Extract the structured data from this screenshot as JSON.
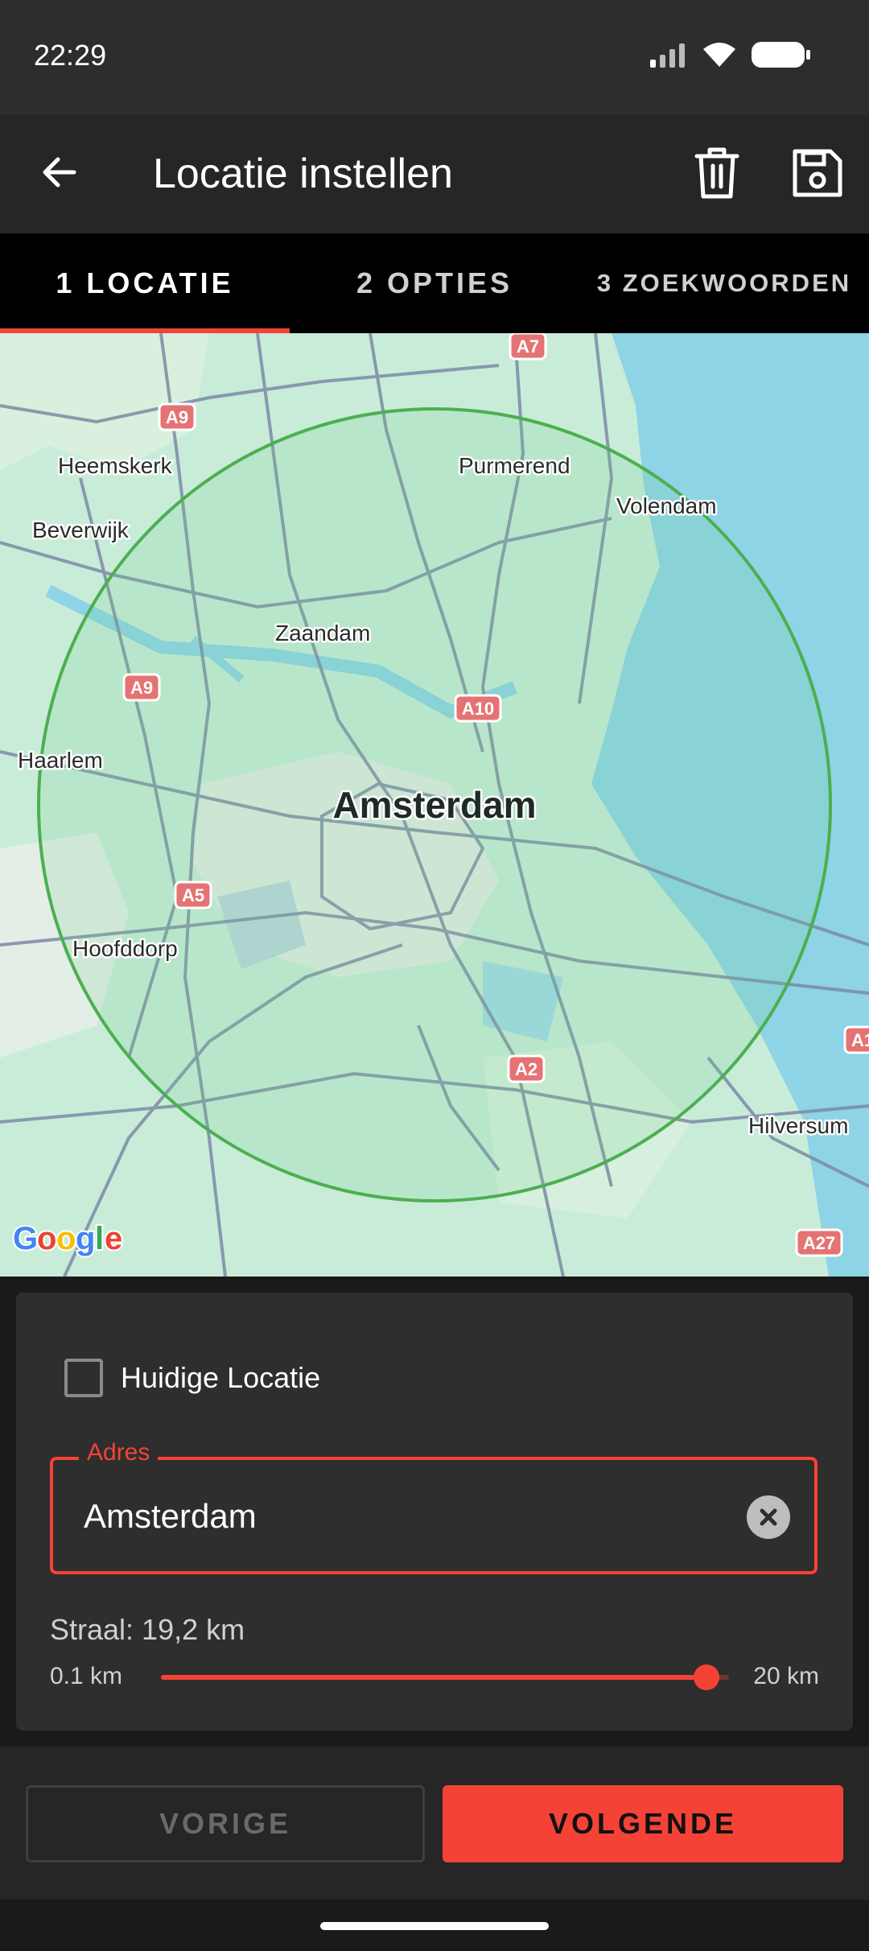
{
  "status_bar": {
    "time": "22:29"
  },
  "app_bar": {
    "title": "Locatie instellen"
  },
  "tabs": [
    {
      "label": "1 LOCATIE",
      "active": true
    },
    {
      "label": "2 OPTIES",
      "active": false
    },
    {
      "label": "3 ZOEKWOORDEN",
      "active": false
    }
  ],
  "map": {
    "center_label": "Amsterdam",
    "places": [
      "Heemskerk",
      "Beverwijk",
      "Purmerend",
      "Volendam",
      "Zaandam",
      "Haarlem",
      "Hoofddorp",
      "Hilversum"
    ],
    "road_shields": [
      "A7",
      "A9",
      "A9",
      "A10",
      "A5",
      "A2",
      "A1",
      "A27"
    ],
    "attribution": "Google",
    "radius_circle_color": "#4caf50"
  },
  "form": {
    "current_location_label": "Huidige Locatie",
    "current_location_checked": false,
    "address_label": "Adres",
    "address_value": "Amsterdam",
    "radius_label": "Straal: 19,2 km",
    "slider_min": "0.1 km",
    "slider_max": "20 km",
    "slider_value_km": 19.2,
    "slider_min_km": 0.1,
    "slider_max_km": 20
  },
  "buttons": {
    "previous": "VORIGE",
    "next": "VOLGENDE"
  },
  "colors": {
    "accent": "#f44336",
    "background": "#1a1a1a",
    "panel": "#2e2e2e",
    "circle": "#4caf50"
  }
}
